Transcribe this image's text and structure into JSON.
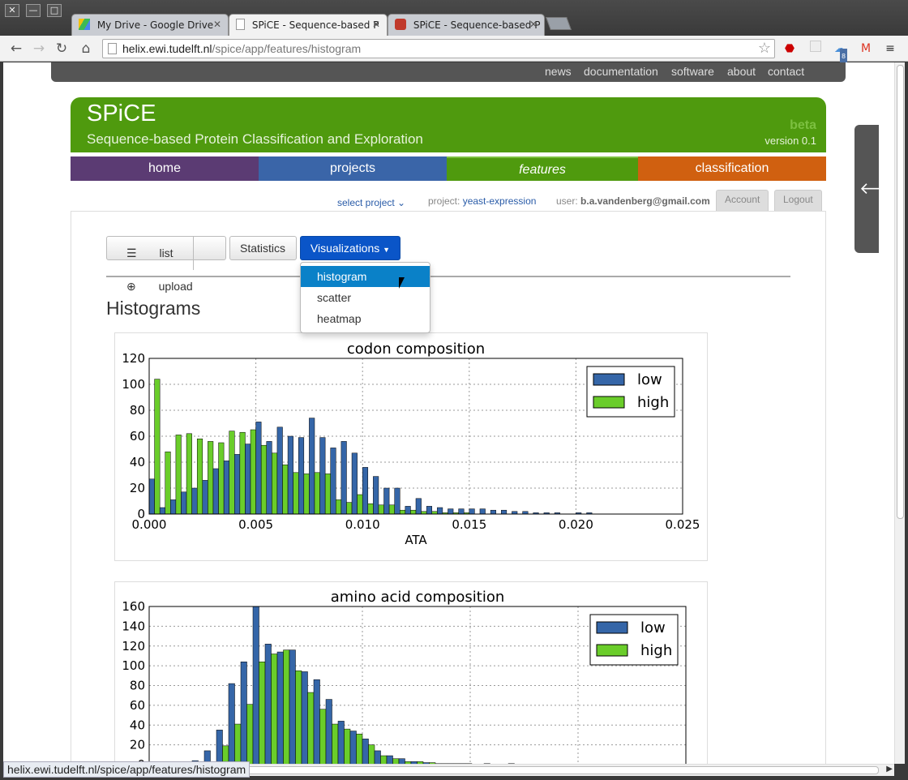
{
  "browser": {
    "tabs": [
      {
        "title": "My Drive - Google Drive"
      },
      {
        "title": "SPiCE - Sequence-based P"
      },
      {
        "title": "SPiCE - Sequence-based P"
      }
    ],
    "url_host": "helix.ewi.tudelft.nl",
    "url_path": "/spice/app/features/histogram",
    "status_url": "helix.ewi.tudelft.nl/spice/app/features/histogram",
    "ext_badge": "8"
  },
  "topnav": [
    "news",
    "documentation",
    "software",
    "about",
    "contact"
  ],
  "banner": {
    "brand": "SPiCE",
    "tagline": "Sequence-based Protein Classification and Exploration",
    "beta": "beta",
    "version": "version 0.1",
    "color": "#4f9a0e"
  },
  "mainnav": [
    {
      "label": "home",
      "color": "#5b3b73"
    },
    {
      "label": "projects",
      "color": "#3a65a8"
    },
    {
      "label": "features",
      "color": "#4f9a0e"
    },
    {
      "label": "classification",
      "color": "#d06010"
    }
  ],
  "userbar": {
    "select_project": "select project",
    "project_label": "project:",
    "project_name": "yeast-expression",
    "user_label": "user:",
    "user_email": "b.a.vandenberg@gmail.com",
    "account": "Account",
    "logout": "Logout"
  },
  "toolbar": {
    "list": "list",
    "upload": "upload",
    "statistics": "Statistics",
    "visualizations": "Visualizations"
  },
  "dropdown": [
    "histogram",
    "scatter",
    "heatmap"
  ],
  "page_title": "Histograms",
  "chart_data": [
    {
      "type": "bar",
      "title": "codon composition",
      "xlabel": "ATA",
      "ylabel": "",
      "xlim": [
        0.0,
        0.025
      ],
      "ylim": [
        0,
        120
      ],
      "xticks": [
        "0.000",
        "0.005",
        "0.010",
        "0.015",
        "0.020",
        "0.025"
      ],
      "yticks": [
        "0",
        "20",
        "40",
        "60",
        "80",
        "100",
        "120"
      ],
      "legend_position": "top-right",
      "bin_width": 0.0005,
      "x": [
        0.0,
        0.0005,
        0.001,
        0.0015,
        0.002,
        0.0025,
        0.003,
        0.0035,
        0.004,
        0.0045,
        0.005,
        0.0055,
        0.006,
        0.0065,
        0.007,
        0.0075,
        0.008,
        0.0085,
        0.009,
        0.0095,
        0.01,
        0.0105,
        0.011,
        0.0115,
        0.012,
        0.0125,
        0.013,
        0.0135,
        0.014,
        0.0145,
        0.015,
        0.0155,
        0.016,
        0.0165,
        0.017,
        0.0175,
        0.018,
        0.0185,
        0.019,
        0.0195,
        0.02,
        0.0205
      ],
      "series": [
        {
          "name": "low",
          "color": "#3566a8",
          "values": [
            27,
            5,
            11,
            17,
            20,
            26,
            35,
            41,
            46,
            54,
            71,
            56,
            67,
            60,
            59,
            74,
            59,
            51,
            56,
            47,
            36,
            29,
            20,
            20,
            6,
            12,
            6,
            5,
            4,
            4,
            4,
            4,
            3,
            3,
            2,
            2,
            1,
            1,
            1,
            0,
            1,
            1
          ]
        },
        {
          "name": "high",
          "color": "#6acd2a",
          "values": [
            104,
            48,
            61,
            62,
            58,
            56,
            55,
            64,
            63,
            65,
            53,
            47,
            38,
            32,
            31,
            32,
            31,
            11,
            9,
            15,
            8,
            7,
            7,
            3,
            3,
            2,
            2,
            1,
            1,
            1,
            0,
            0,
            0,
            0,
            0,
            0,
            0,
            0,
            0,
            0,
            0,
            0
          ]
        }
      ]
    },
    {
      "type": "bar",
      "title": "amino acid composition",
      "xlabel": "",
      "ylabel": "",
      "ylim": [
        0,
        160
      ],
      "yticks": [
        "0",
        "20",
        "40",
        "60",
        "80",
        "100",
        "120",
        "140",
        "160"
      ],
      "legend_position": "top-right",
      "series": [
        {
          "name": "low",
          "color": "#3566a8",
          "values": [
            3,
            2,
            1,
            4,
            14,
            35,
            82,
            104,
            160,
            122,
            114,
            116,
            94,
            86,
            66,
            44,
            34,
            26,
            14,
            9,
            6,
            3,
            2,
            1,
            1,
            1,
            0,
            1,
            0,
            1
          ]
        },
        {
          "name": "high",
          "color": "#6acd2a",
          "values": [
            0,
            0,
            0,
            0,
            0,
            19,
            41,
            61,
            104,
            112,
            116,
            95,
            73,
            56,
            41,
            36,
            31,
            20,
            9,
            6,
            3,
            3,
            2,
            1,
            1,
            1,
            0,
            0,
            0,
            0
          ]
        }
      ]
    }
  ]
}
